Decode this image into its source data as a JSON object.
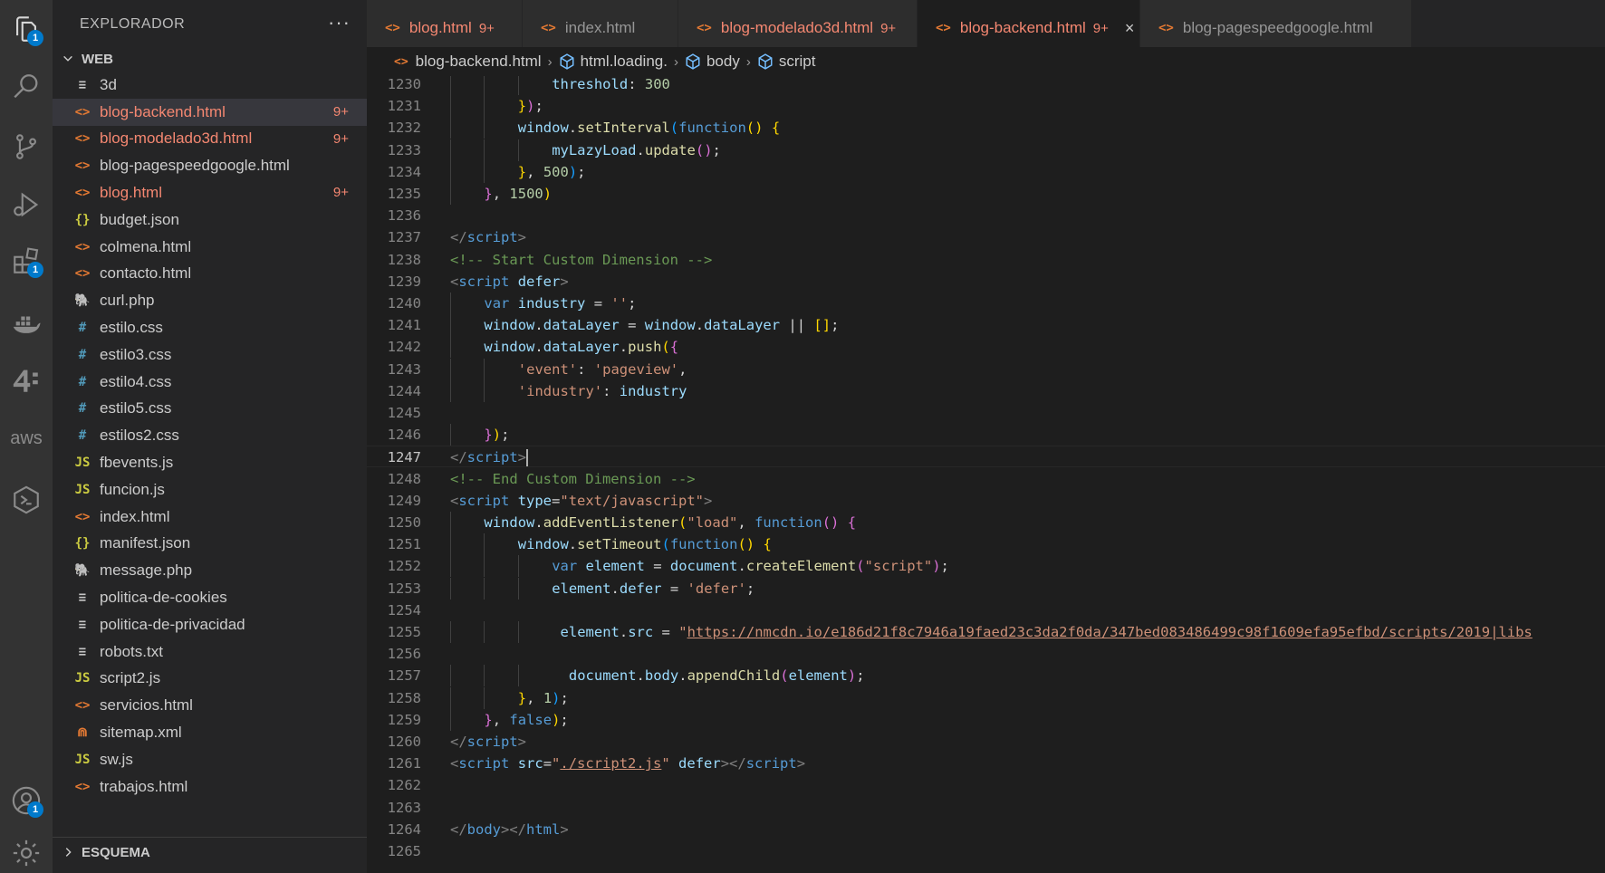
{
  "sidebar": {
    "title": "EXPLORADOR",
    "more": "···",
    "folder": "WEB",
    "outline": "ESQUEMA",
    "files": [
      {
        "name": "3d",
        "icon": "≡",
        "color": "#c5c5c5",
        "modified": false,
        "badge": ""
      },
      {
        "name": "blog-backend.html",
        "icon": "<>",
        "color": "#e37933",
        "modified": true,
        "badge": "9+",
        "selected": true
      },
      {
        "name": "blog-modelado3d.html",
        "icon": "<>",
        "color": "#e37933",
        "modified": true,
        "badge": "9+"
      },
      {
        "name": "blog-pagespeedgoogle.html",
        "icon": "<>",
        "color": "#e37933",
        "modified": false,
        "badge": ""
      },
      {
        "name": "blog.html",
        "icon": "<>",
        "color": "#e37933",
        "modified": true,
        "badge": "9+"
      },
      {
        "name": "budget.json",
        "icon": "{}",
        "color": "#cbcb41",
        "modified": false,
        "badge": ""
      },
      {
        "name": "colmena.html",
        "icon": "<>",
        "color": "#e37933",
        "modified": false,
        "badge": ""
      },
      {
        "name": "contacto.html",
        "icon": "<>",
        "color": "#e37933",
        "modified": false,
        "badge": ""
      },
      {
        "name": "curl.php",
        "icon": "🐘",
        "color": "#a074c4",
        "modified": false,
        "badge": ""
      },
      {
        "name": "estilo.css",
        "icon": "#",
        "color": "#519aba",
        "modified": false,
        "badge": ""
      },
      {
        "name": "estilo3.css",
        "icon": "#",
        "color": "#519aba",
        "modified": false,
        "badge": ""
      },
      {
        "name": "estilo4.css",
        "icon": "#",
        "color": "#519aba",
        "modified": false,
        "badge": ""
      },
      {
        "name": "estilo5.css",
        "icon": "#",
        "color": "#519aba",
        "modified": false,
        "badge": ""
      },
      {
        "name": "estilos2.css",
        "icon": "#",
        "color": "#519aba",
        "modified": false,
        "badge": ""
      },
      {
        "name": "fbevents.js",
        "icon": "JS",
        "color": "#cbcb41",
        "modified": false,
        "badge": ""
      },
      {
        "name": "funcion.js",
        "icon": "JS",
        "color": "#cbcb41",
        "modified": false,
        "badge": ""
      },
      {
        "name": "index.html",
        "icon": "<>",
        "color": "#e37933",
        "modified": false,
        "badge": ""
      },
      {
        "name": "manifest.json",
        "icon": "{}",
        "color": "#cbcb41",
        "modified": false,
        "badge": ""
      },
      {
        "name": "message.php",
        "icon": "🐘",
        "color": "#a074c4",
        "modified": false,
        "badge": ""
      },
      {
        "name": "politica-de-cookies",
        "icon": "≡",
        "color": "#c5c5c5",
        "modified": false,
        "badge": ""
      },
      {
        "name": "politica-de-privacidad",
        "icon": "≡",
        "color": "#c5c5c5",
        "modified": false,
        "badge": ""
      },
      {
        "name": "robots.txt",
        "icon": "≡",
        "color": "#c5c5c5",
        "modified": false,
        "badge": ""
      },
      {
        "name": "script2.js",
        "icon": "JS",
        "color": "#cbcb41",
        "modified": false,
        "badge": ""
      },
      {
        "name": "servicios.html",
        "icon": "<>",
        "color": "#e37933",
        "modified": false,
        "badge": ""
      },
      {
        "name": "sitemap.xml",
        "icon": "⋒",
        "color": "#e37933",
        "modified": false,
        "badge": ""
      },
      {
        "name": "sw.js",
        "icon": "JS",
        "color": "#cbcb41",
        "modified": false,
        "badge": ""
      },
      {
        "name": "trabajos.html",
        "icon": "<>",
        "color": "#e37933",
        "modified": false,
        "badge": ""
      }
    ]
  },
  "activity": {
    "badges": {
      "explorer": "1",
      "extensions": "1",
      "accounts": "1"
    },
    "icons": [
      "files-icon",
      "search-icon",
      "source-control-icon",
      "run-debug-icon",
      "extensions-icon",
      "docker-icon",
      "forty-two-icon",
      "aws-icon",
      "remote-explorer-icon",
      "account-icon",
      "settings-gear-icon"
    ],
    "aws_label": "aws"
  },
  "tabs": [
    {
      "label": "blog.html",
      "badge": "9+",
      "modified": true,
      "dirty": true
    },
    {
      "label": "index.html",
      "badge": "",
      "modified": false
    },
    {
      "label": "blog-modelado3d.html",
      "badge": "9+",
      "modified": true
    },
    {
      "label": "blog-backend.html",
      "badge": "9+",
      "modified": true,
      "active": true,
      "close": "×"
    },
    {
      "label": "blog-pagespeedgoogle.html",
      "badge": "",
      "modified": false
    }
  ],
  "breadcrumb": {
    "file": "blog-backend.html",
    "items": [
      "html.loading.",
      "body",
      "script"
    ]
  },
  "editor": {
    "current_line": 1247,
    "lines": [
      {
        "n": 1230,
        "indent": 3,
        "tokens": [
          [
            "var",
            "threshold"
          ],
          [
            "pl",
            ": "
          ],
          [
            "num",
            "300"
          ]
        ]
      },
      {
        "n": 1231,
        "indent": 2,
        "tokens": [
          [
            "p1",
            "}"
          ],
          [
            "p2",
            ")"
          ],
          [
            "pl",
            ";"
          ]
        ]
      },
      {
        "n": 1232,
        "indent": 2,
        "tokens": [
          [
            "var",
            "window"
          ],
          [
            "pl",
            "."
          ],
          [
            "fn",
            "setInterval"
          ],
          [
            "p3",
            "("
          ],
          [
            "kw",
            "function"
          ],
          [
            "p1",
            "()"
          ],
          [
            "pl",
            " "
          ],
          [
            "p1",
            "{"
          ]
        ]
      },
      {
        "n": 1233,
        "indent": 3,
        "tokens": [
          [
            "var",
            "myLazyLoad"
          ],
          [
            "pl",
            "."
          ],
          [
            "fn",
            "update"
          ],
          [
            "p2",
            "()"
          ],
          [
            "pl",
            ";"
          ]
        ]
      },
      {
        "n": 1234,
        "indent": 2,
        "tokens": [
          [
            "p1",
            "}"
          ],
          [
            "pl",
            ", "
          ],
          [
            "num",
            "500"
          ],
          [
            "p3",
            ")"
          ],
          [
            "pl",
            ";"
          ]
        ]
      },
      {
        "n": 1235,
        "indent": 1,
        "tokens": [
          [
            "p2",
            "}"
          ],
          [
            "pl",
            ", "
          ],
          [
            "num",
            "1500"
          ],
          [
            "p1",
            ")"
          ]
        ]
      },
      {
        "n": 1236,
        "indent": 0,
        "tokens": []
      },
      {
        "n": 1237,
        "indent": 0,
        "tokens": [
          [
            "br",
            "</"
          ],
          [
            "tag",
            "script"
          ],
          [
            "br",
            ">"
          ]
        ]
      },
      {
        "n": 1238,
        "indent": 0,
        "tokens": [
          [
            "cmt",
            "<!-- Start Custom Dimension -->"
          ]
        ]
      },
      {
        "n": 1239,
        "indent": 0,
        "tokens": [
          [
            "br",
            "<"
          ],
          [
            "tag",
            "script"
          ],
          [
            "pl",
            " "
          ],
          [
            "attr",
            "defer"
          ],
          [
            "br",
            ">"
          ]
        ]
      },
      {
        "n": 1240,
        "indent": 1,
        "tokens": [
          [
            "kw",
            "var"
          ],
          [
            "pl",
            " "
          ],
          [
            "var",
            "industry"
          ],
          [
            "pl",
            " = "
          ],
          [
            "str",
            "''"
          ],
          [
            "pl",
            ";"
          ]
        ]
      },
      {
        "n": 1241,
        "indent": 1,
        "tokens": [
          [
            "var",
            "window"
          ],
          [
            "pl",
            "."
          ],
          [
            "var",
            "dataLayer"
          ],
          [
            "pl",
            " = "
          ],
          [
            "var",
            "window"
          ],
          [
            "pl",
            "."
          ],
          [
            "var",
            "dataLayer"
          ],
          [
            "pl",
            " || "
          ],
          [
            "p1",
            "[]"
          ],
          [
            "pl",
            ";"
          ]
        ]
      },
      {
        "n": 1242,
        "indent": 1,
        "tokens": [
          [
            "var",
            "window"
          ],
          [
            "pl",
            "."
          ],
          [
            "var",
            "dataLayer"
          ],
          [
            "pl",
            "."
          ],
          [
            "fn",
            "push"
          ],
          [
            "p1",
            "("
          ],
          [
            "p2",
            "{"
          ]
        ]
      },
      {
        "n": 1243,
        "indent": 2,
        "tokens": [
          [
            "str",
            "'event'"
          ],
          [
            "pl",
            ": "
          ],
          [
            "str",
            "'pageview'"
          ],
          [
            "pl",
            ","
          ]
        ]
      },
      {
        "n": 1244,
        "indent": 2,
        "tokens": [
          [
            "str",
            "'industry'"
          ],
          [
            "pl",
            ": "
          ],
          [
            "var",
            "industry"
          ]
        ]
      },
      {
        "n": 1245,
        "indent": 0,
        "tokens": []
      },
      {
        "n": 1246,
        "indent": 1,
        "tokens": [
          [
            "p2",
            "}"
          ],
          [
            "p1",
            ")"
          ],
          [
            "pl",
            ";"
          ]
        ]
      },
      {
        "n": 1247,
        "indent": 0,
        "tokens": [
          [
            "br",
            "</"
          ],
          [
            "tag",
            "script"
          ],
          [
            "br",
            ">"
          ]
        ],
        "cursor": true
      },
      {
        "n": 1248,
        "indent": 0,
        "tokens": [
          [
            "cmt",
            "<!-- End Custom Dimension -->"
          ]
        ]
      },
      {
        "n": 1249,
        "indent": 0,
        "tokens": [
          [
            "br",
            "<"
          ],
          [
            "tag",
            "script"
          ],
          [
            "pl",
            " "
          ],
          [
            "attr",
            "type"
          ],
          [
            "pl",
            "="
          ],
          [
            "str",
            "\"text/javascript\""
          ],
          [
            "br",
            ">"
          ]
        ]
      },
      {
        "n": 1250,
        "indent": 1,
        "tokens": [
          [
            "var",
            "window"
          ],
          [
            "pl",
            "."
          ],
          [
            "fn",
            "addEventListener"
          ],
          [
            "p1",
            "("
          ],
          [
            "str",
            "\"load\""
          ],
          [
            "pl",
            ", "
          ],
          [
            "kw",
            "function"
          ],
          [
            "p2",
            "()"
          ],
          [
            "pl",
            " "
          ],
          [
            "p2",
            "{"
          ]
        ]
      },
      {
        "n": 1251,
        "indent": 2,
        "tokens": [
          [
            "var",
            "window"
          ],
          [
            "pl",
            "."
          ],
          [
            "fn",
            "setTimeout"
          ],
          [
            "p3",
            "("
          ],
          [
            "kw",
            "function"
          ],
          [
            "p1",
            "()"
          ],
          [
            "pl",
            " "
          ],
          [
            "p1",
            "{"
          ]
        ]
      },
      {
        "n": 1252,
        "indent": 3,
        "tokens": [
          [
            "kw",
            "var"
          ],
          [
            "pl",
            " "
          ],
          [
            "var",
            "element"
          ],
          [
            "pl",
            " = "
          ],
          [
            "var",
            "document"
          ],
          [
            "pl",
            "."
          ],
          [
            "fn",
            "createElement"
          ],
          [
            "p2",
            "("
          ],
          [
            "str",
            "\"script\""
          ],
          [
            "p2",
            ")"
          ],
          [
            "pl",
            ";"
          ]
        ]
      },
      {
        "n": 1253,
        "indent": 3,
        "tokens": [
          [
            "var",
            "element"
          ],
          [
            "pl",
            "."
          ],
          [
            "var",
            "defer"
          ],
          [
            "pl",
            " = "
          ],
          [
            "str",
            "'defer'"
          ],
          [
            "pl",
            ";"
          ]
        ]
      },
      {
        "n": 1254,
        "indent": 0,
        "tokens": []
      },
      {
        "n": 1255,
        "indent": 3,
        "pad": 1,
        "tokens": [
          [
            "var",
            "element"
          ],
          [
            "pl",
            "."
          ],
          [
            "var",
            "src"
          ],
          [
            "pl",
            " = "
          ],
          [
            "str",
            "\""
          ],
          [
            "link",
            "https://nmcdn.io/e186d21f8c7946a19faed23c3da2f0da/347bed083486499c98f1609efa95efbd/scripts/2019|libs"
          ]
        ]
      },
      {
        "n": 1256,
        "indent": 0,
        "tokens": []
      },
      {
        "n": 1257,
        "indent": 3,
        "pad": 2,
        "tokens": [
          [
            "var",
            "document"
          ],
          [
            "pl",
            "."
          ],
          [
            "var",
            "body"
          ],
          [
            "pl",
            "."
          ],
          [
            "fn",
            "appendChild"
          ],
          [
            "p2",
            "("
          ],
          [
            "var",
            "element"
          ],
          [
            "p2",
            ")"
          ],
          [
            "pl",
            ";"
          ]
        ]
      },
      {
        "n": 1258,
        "indent": 2,
        "tokens": [
          [
            "p1",
            "}"
          ],
          [
            "pl",
            ", "
          ],
          [
            "num",
            "1"
          ],
          [
            "p3",
            ")"
          ],
          [
            "pl",
            ";"
          ]
        ]
      },
      {
        "n": 1259,
        "indent": 1,
        "tokens": [
          [
            "p2",
            "}"
          ],
          [
            "pl",
            ", "
          ],
          [
            "kw",
            "false"
          ],
          [
            "p1",
            ")"
          ],
          [
            "pl",
            ";"
          ]
        ]
      },
      {
        "n": 1260,
        "indent": 0,
        "tokens": [
          [
            "br",
            "</"
          ],
          [
            "tag",
            "script"
          ],
          [
            "br",
            ">"
          ]
        ]
      },
      {
        "n": 1261,
        "indent": 0,
        "tokens": [
          [
            "br",
            "<"
          ],
          [
            "tag",
            "script"
          ],
          [
            "pl",
            " "
          ],
          [
            "attr",
            "src"
          ],
          [
            "pl",
            "="
          ],
          [
            "str",
            "\""
          ],
          [
            "link",
            "./script2.js"
          ],
          [
            "str",
            "\""
          ],
          [
            "pl",
            " "
          ],
          [
            "attr",
            "defer"
          ],
          [
            "br",
            "></"
          ],
          [
            "tag",
            "script"
          ],
          [
            "br",
            ">"
          ]
        ]
      },
      {
        "n": 1262,
        "indent": 0,
        "tokens": []
      },
      {
        "n": 1263,
        "indent": 0,
        "tokens": []
      },
      {
        "n": 1264,
        "indent": 0,
        "tokens": [
          [
            "br",
            "</"
          ],
          [
            "tag",
            "body"
          ],
          [
            "br",
            "></"
          ],
          [
            "tag",
            "html"
          ],
          [
            "br",
            ">"
          ]
        ]
      },
      {
        "n": 1265,
        "indent": 0,
        "tokens": []
      }
    ]
  }
}
